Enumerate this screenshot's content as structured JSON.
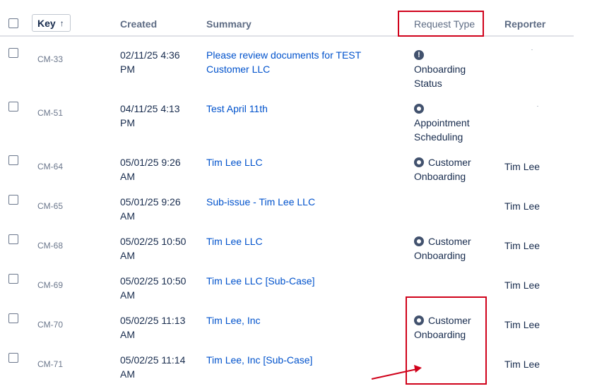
{
  "columns": {
    "key": "Key",
    "created": "Created",
    "summary": "Summary",
    "request_type": "Request Type",
    "reporter": "Reporter"
  },
  "sort_indicator": "↑",
  "rows": [
    {
      "key": "CM-33",
      "created": "02/11/25 4:36 PM",
      "summary": "Please review documents for TEST Customer LLC",
      "request_type": "Onboarding Status",
      "request_type_icon": "alert-icon",
      "reporter": ""
    },
    {
      "key": "CM-51",
      "created": "04/11/25 4:13 PM",
      "summary": "Test April 11th",
      "request_type": "Appointment Scheduling",
      "request_type_icon": "gear-icon",
      "reporter": ""
    },
    {
      "key": "CM-64",
      "created": "05/01/25 9:26 AM",
      "summary": "Tim Lee LLC",
      "request_type": "Customer Onboarding",
      "request_type_icon": "gear-icon",
      "reporter": "Tim Lee"
    },
    {
      "key": "CM-65",
      "created": "05/01/25 9:26 AM",
      "summary": "Sub-issue - Tim Lee LLC",
      "request_type": "",
      "request_type_icon": "",
      "reporter": "Tim Lee"
    },
    {
      "key": "CM-68",
      "created": "05/02/25 10:50 AM",
      "summary": "Tim Lee LLC",
      "request_type": "Customer Onboarding",
      "request_type_icon": "gear-icon",
      "reporter": "Tim Lee"
    },
    {
      "key": "CM-69",
      "created": "05/02/25 10:50 AM",
      "summary": "Tim Lee LLC [Sub-Case]",
      "request_type": "",
      "request_type_icon": "",
      "reporter": "Tim Lee"
    },
    {
      "key": "CM-70",
      "created": "05/02/25 11:13 AM",
      "summary": "Tim Lee, Inc",
      "request_type": "Customer Onboarding",
      "request_type_icon": "gear-icon",
      "reporter": "Tim Lee"
    },
    {
      "key": "CM-71",
      "created": "05/02/25 11:14 AM",
      "summary": "Tim Lee, Inc [Sub-Case]",
      "request_type": "",
      "request_type_icon": "",
      "reporter": "Tim Lee"
    }
  ],
  "colors": {
    "link": "#0052cc",
    "annotation": "#d0021b"
  }
}
